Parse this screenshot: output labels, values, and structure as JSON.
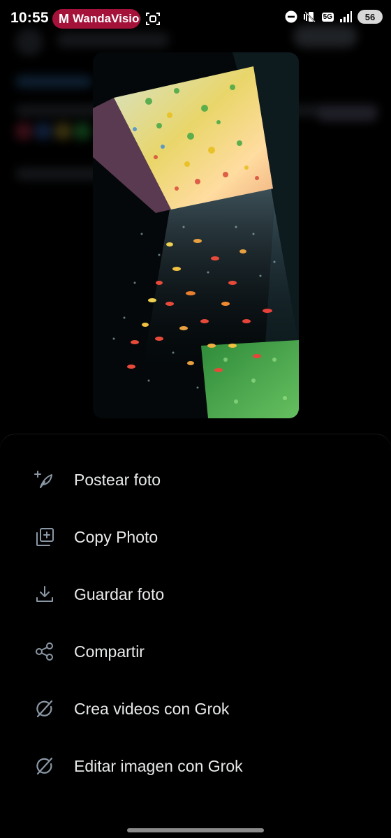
{
  "status_bar": {
    "time": "10:55",
    "app_pill": {
      "logo": "M",
      "label": "WandaVision",
      "color": "#a4123a"
    },
    "network": "5G",
    "battery": "56"
  },
  "menu": {
    "items": [
      {
        "label": "Postear foto",
        "icon": "feather-plus-icon"
      },
      {
        "label": "Copy Photo",
        "icon": "copy-plus-icon"
      },
      {
        "label": "Guardar foto",
        "icon": "download-icon"
      },
      {
        "label": "Compartir",
        "icon": "share-icon"
      },
      {
        "label": "Crea videos con Grok",
        "icon": "grok-icon"
      },
      {
        "label": "Editar imagen con Grok",
        "icon": "grok-icon"
      }
    ]
  },
  "colors": {
    "background": "#000000",
    "text": "#e7e9ea",
    "icon": "#8b98a5"
  }
}
